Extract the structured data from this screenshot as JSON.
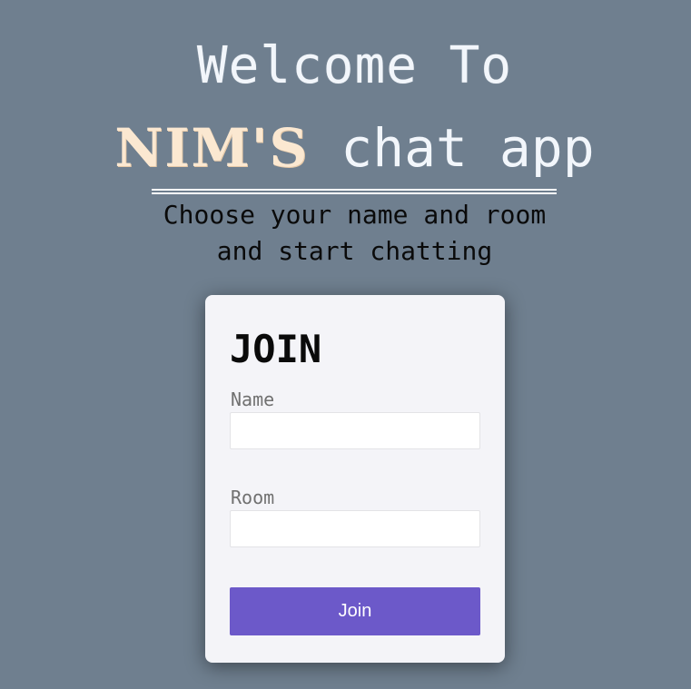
{
  "header": {
    "welcome": "Welcome To",
    "brand": "NIM'S",
    "app": "chat app",
    "subtitle_line1": "Choose your name and room",
    "subtitle_line2": "and start chatting"
  },
  "join_form": {
    "title": "JOIN",
    "name_label": "Name",
    "name_value": "",
    "room_label": "Room",
    "room_value": "",
    "submit_label": "Join"
  },
  "colors": {
    "background": "#6f7f8f",
    "brand": "#fbe8d1",
    "card": "#f4f4f8",
    "button": "#6c59c9"
  }
}
